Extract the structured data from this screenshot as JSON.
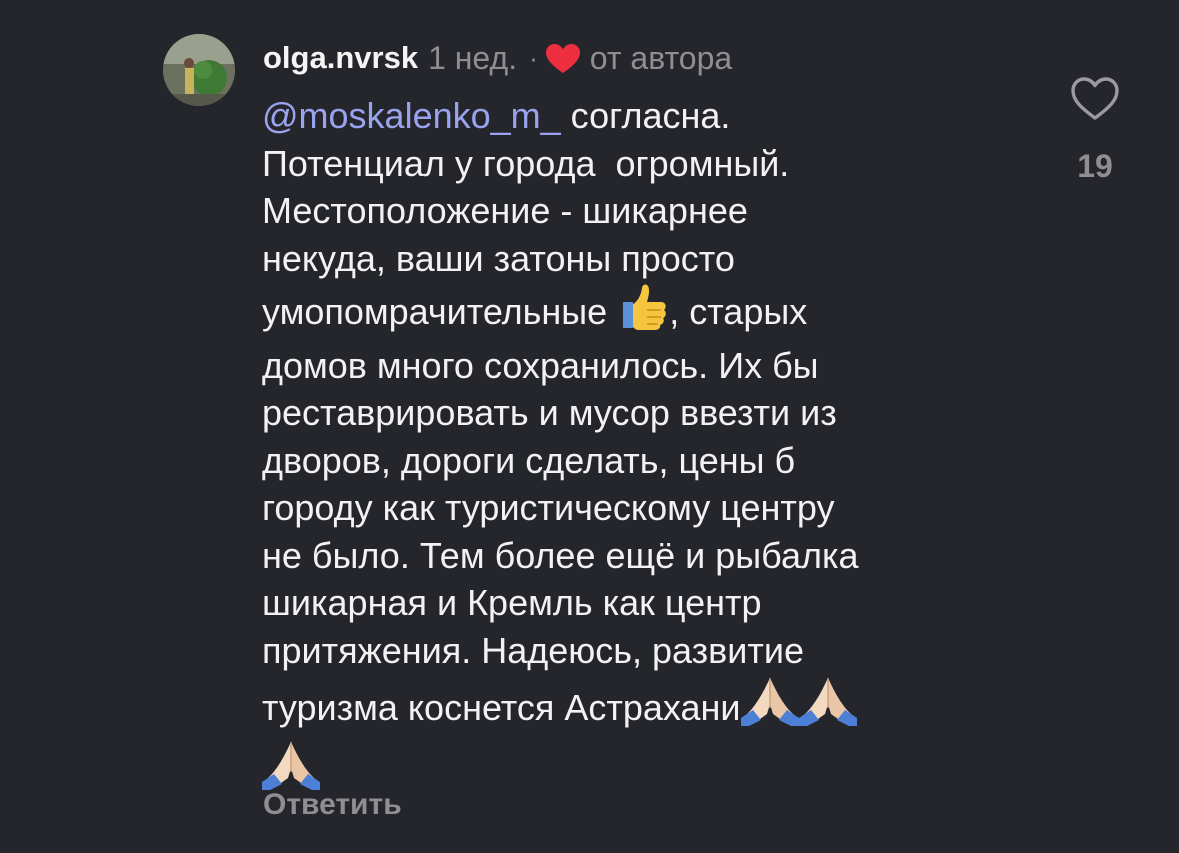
{
  "comment": {
    "username": "olga.nvrsk",
    "time": "1 нед.",
    "separator": "·",
    "author_badge": "от автора",
    "mention": "@moskalenko_m_",
    "text_1": " согласна.\nПотенциал у города  огромный.\nМестоположение - шикарнее\nнекуда, ваши затоны просто\nумопомрачительные ",
    "text_2": ", старых\nдомов много сохранилось. Их бы\nреставрировать и мусор ввезти из\nдворов, дороги сделать, цены б\nгороду как туристическому центру\nне было. Тем более ещё и рыбалка\nшикарная и Кремль как центр\nпритяжения. Надеюсь, развитие\nтуризма коснется Астрахани",
    "reply_label": "Ответить",
    "like_count": "19"
  },
  "icons": {
    "author_like": "heart-filled-icon",
    "like": "heart-outline-icon",
    "thumbs_up": "thumbs-up-emoji",
    "pray": "folded-hands-emoji"
  },
  "colors": {
    "background": "#25262b",
    "mention": "#9aa3ee",
    "heart_red": "#ed2f3f",
    "secondary": "#8e8e93"
  }
}
